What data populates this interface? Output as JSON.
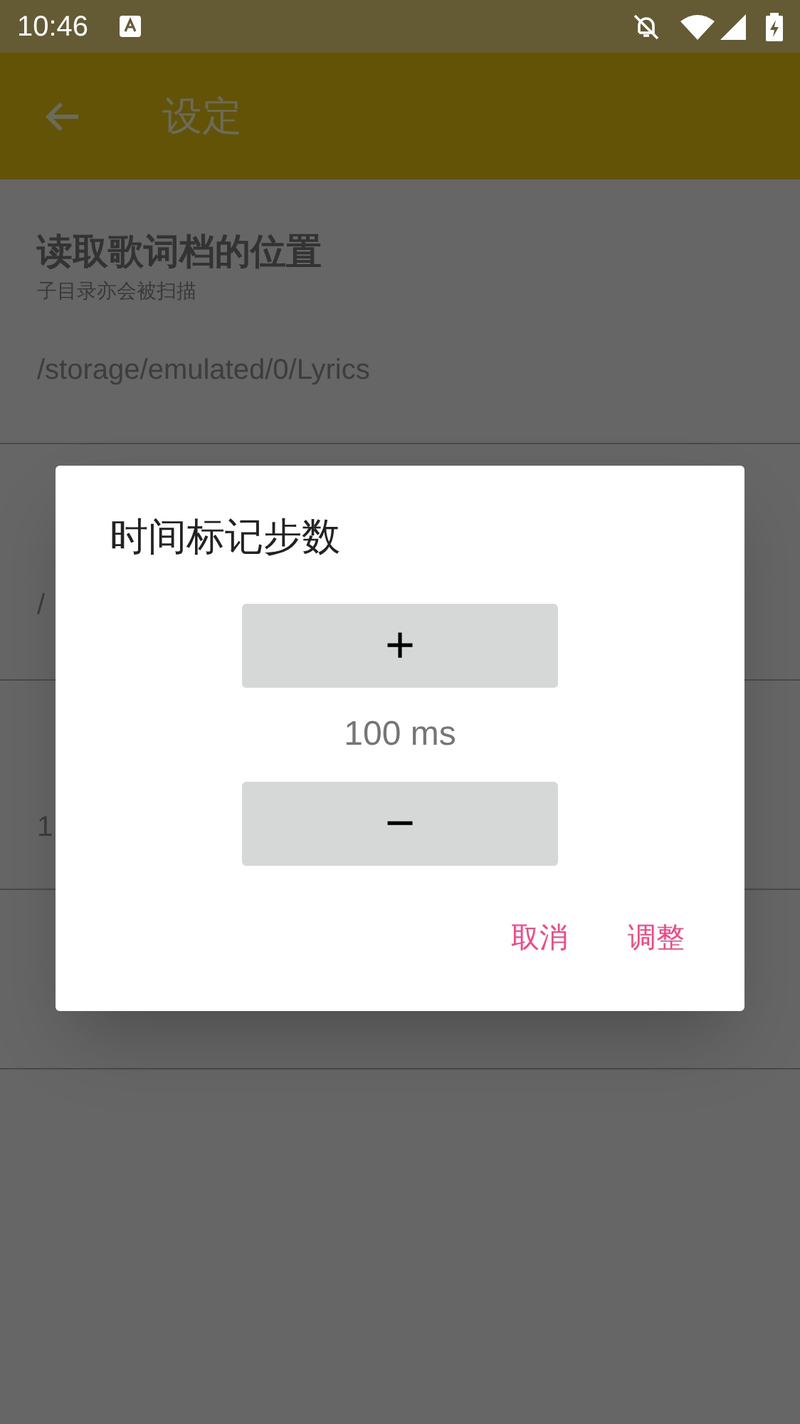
{
  "status_bar": {
    "time": "10:46"
  },
  "app_bar": {
    "title": "设定"
  },
  "settings": [
    {
      "title": "读取歌词档的位置",
      "subtitle": "子目录亦会被扫描",
      "value": "/storage/emulated/0/Lyrics"
    },
    {
      "value": "/"
    },
    {
      "value": "1"
    }
  ],
  "dialog": {
    "title": "时间标记步数",
    "increment": "+",
    "reading": "100 ms",
    "decrement": "−",
    "buttons": [
      "取消",
      "调整"
    ]
  }
}
